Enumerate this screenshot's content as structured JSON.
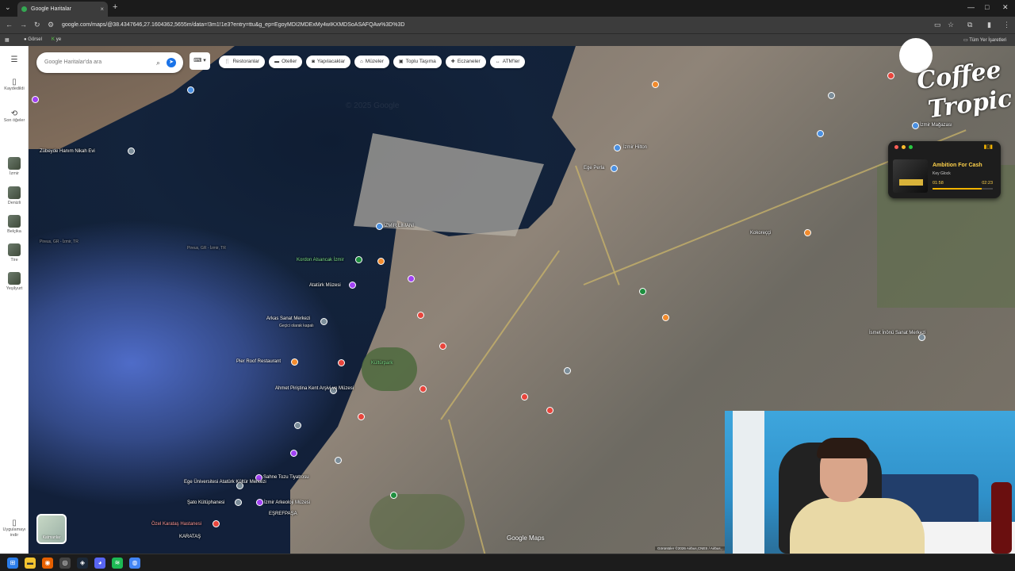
{
  "browser": {
    "tab_title": "Google Haritalar",
    "tab_close": "×",
    "new_tab": "+",
    "url": "google.com/maps/@38.4347646,27.1604362,5655m/data=!3m1!1e3?entry=ttu&g_ep=EgoyMDI2MDExMy4wIKXMDSoASAFQAw%3D%3D",
    "bookmarks": [
      "Görsel",
      "ye"
    ],
    "all_bookmarks": "Tüm Yer İşaretleri",
    "window_controls": [
      "—",
      "□",
      "✕"
    ]
  },
  "left_rail": {
    "items": [
      {
        "label": "Kaydedildi",
        "icon": "bookmark-icon"
      },
      {
        "label": "Son öğeler",
        "icon": "history-icon"
      },
      {
        "label": "İzmir",
        "icon": "place-thumb"
      },
      {
        "label": "Denizli",
        "icon": "place-thumb"
      },
      {
        "label": "Belçika",
        "icon": "place-thumb"
      },
      {
        "label": "Tire",
        "icon": "place-thumb"
      },
      {
        "label": "Yeşilyurt",
        "icon": "place-thumb"
      }
    ],
    "app_download": "Uygulamayı indir"
  },
  "search": {
    "placeholder": "Google Haritalar'da ara"
  },
  "chips": [
    {
      "label": "Restoranlar",
      "icon": "fork-knife-icon"
    },
    {
      "label": "Oteller",
      "icon": "bed-icon"
    },
    {
      "label": "Yapılacaklar",
      "icon": "camera-icon"
    },
    {
      "label": "Müzeler",
      "icon": "museum-icon"
    },
    {
      "label": "Toplu Taşıma",
      "icon": "bus-icon"
    },
    {
      "label": "Eczaneler",
      "icon": "pharmacy-icon"
    },
    {
      "label": "ATM'ler",
      "icon": "atm-icon"
    }
  ],
  "map_labels": {
    "zubeyde": "Zübeyde Hanım Nikah Evi",
    "kordon": "Kordon Alsancak İzmir",
    "ataturk_muzesi": "Atatürk Müzesi",
    "arkas": "Arkas Sanat Merkezi",
    "arkas_sub": "Geçici olarak kapalı",
    "pier_roof": "Pier Roof Restaurant",
    "ahmet": "Ahmet Piriştina Kent Arşivi ve Müzesi",
    "ege_uni": "Ege Üniversitesi Atatürk Kültür Merkezi",
    "sato": "Şato Kütüphanesi",
    "ozel_karatas": "Özel Karataş Hastanesi",
    "karatas": "KARATAŞ",
    "esrefpasa": "EŞREFPAŞA",
    "kulturpark": "Kültürpark",
    "ege_perla": "Ege Perla",
    "izmir_hilton": "İzmir Hilton",
    "kokoreccisi": "Kokoreççi",
    "ismet": "İsmet İnönü Sanat Merkezi",
    "izmir_arkeoloji": "İzmir Arkeoloji Müzesi",
    "sahne": "Sahne Tozu Tiyatrosu",
    "izmir_magaza": "İzmir Mağazası",
    "sea1": "Pireus, GR - İzmir, TR",
    "sea2": "Pireus, GR - İzmir, TR",
    "izmir_port": "İZMİR LİMANI"
  },
  "map_footer": {
    "watermark": "Google Maps",
    "attribution": "Görüntüler ©2026 Airbus,CNES / Airbus,...",
    "layer_label": "Katmanlar"
  },
  "music_widget": {
    "song": "Ambition For Cash",
    "artist": "Key Glock",
    "current_time": "01:58",
    "total_time": "02:23",
    "progress": 0.82
  },
  "logo": {
    "text_line1": "Coffee",
    "text_line2": "Tropic"
  },
  "colors": {
    "accent": "#1a73e8",
    "hospital": "#e8453c",
    "museum": "#a142f4",
    "food": "#f28b2d",
    "park": "#1e8e3e",
    "music_accent": "#f2b300"
  }
}
